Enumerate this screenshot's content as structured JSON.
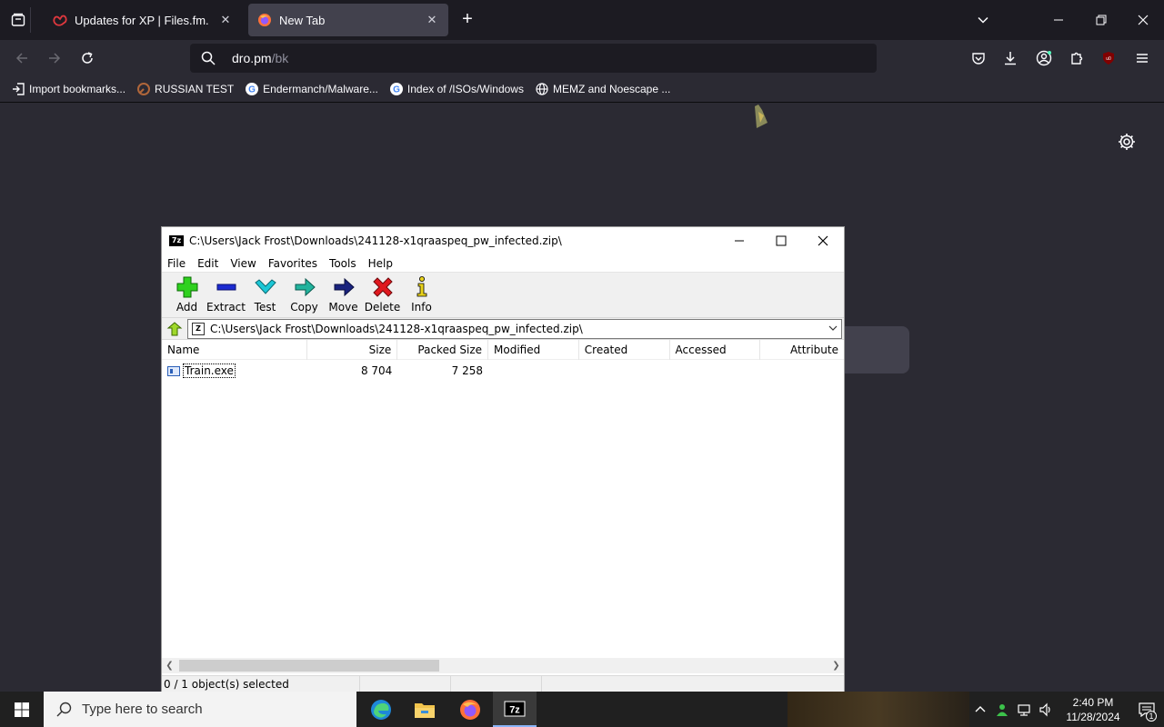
{
  "browser": {
    "tabs": [
      {
        "title": "Updates for XP | Files.fm.",
        "active": false
      },
      {
        "title": "New Tab",
        "active": true
      }
    ],
    "url_host": "dro.pm",
    "url_path": "/bk",
    "bookmarks": [
      {
        "label": "Import bookmarks...",
        "icon": "import-icon"
      },
      {
        "label": "RUSSIAN TEST",
        "icon": "site-icon"
      },
      {
        "label": "Endermanch/Malware...",
        "icon": "google-icon"
      },
      {
        "label": "Index of /ISOs/Windows",
        "icon": "google-icon"
      },
      {
        "label": "MEMZ and Noescape ...",
        "icon": "globe-icon"
      }
    ]
  },
  "sevenzip": {
    "title": "C:\\Users\\Jack Frost\\Downloads\\241128-x1qraaspeq_pw_infected.zip\\",
    "logo": "7z",
    "menu": [
      "File",
      "Edit",
      "View",
      "Favorites",
      "Tools",
      "Help"
    ],
    "toolbar": {
      "add": "Add",
      "extract": "Extract",
      "test": "Test",
      "copy": "Copy",
      "move": "Move",
      "delete": "Delete",
      "info": "Info"
    },
    "address": "C:\\Users\\Jack Frost\\Downloads\\241128-x1qraaspeq_pw_infected.zip\\",
    "columns": {
      "name": "Name",
      "size": "Size",
      "packed": "Packed Size",
      "modified": "Modified",
      "created": "Created",
      "accessed": "Accessed",
      "attributes": "Attribute"
    },
    "files": [
      {
        "name": "Train.exe",
        "size": "8 704",
        "packed": "7 258",
        "modified": "",
        "created": "",
        "accessed": "",
        "attributes": ""
      }
    ],
    "status": "0 / 1 object(s) selected"
  },
  "taskbar": {
    "search_placeholder": "Type here to search",
    "time": "2:40 PM",
    "date": "11/28/2024",
    "notification_count": "1"
  }
}
